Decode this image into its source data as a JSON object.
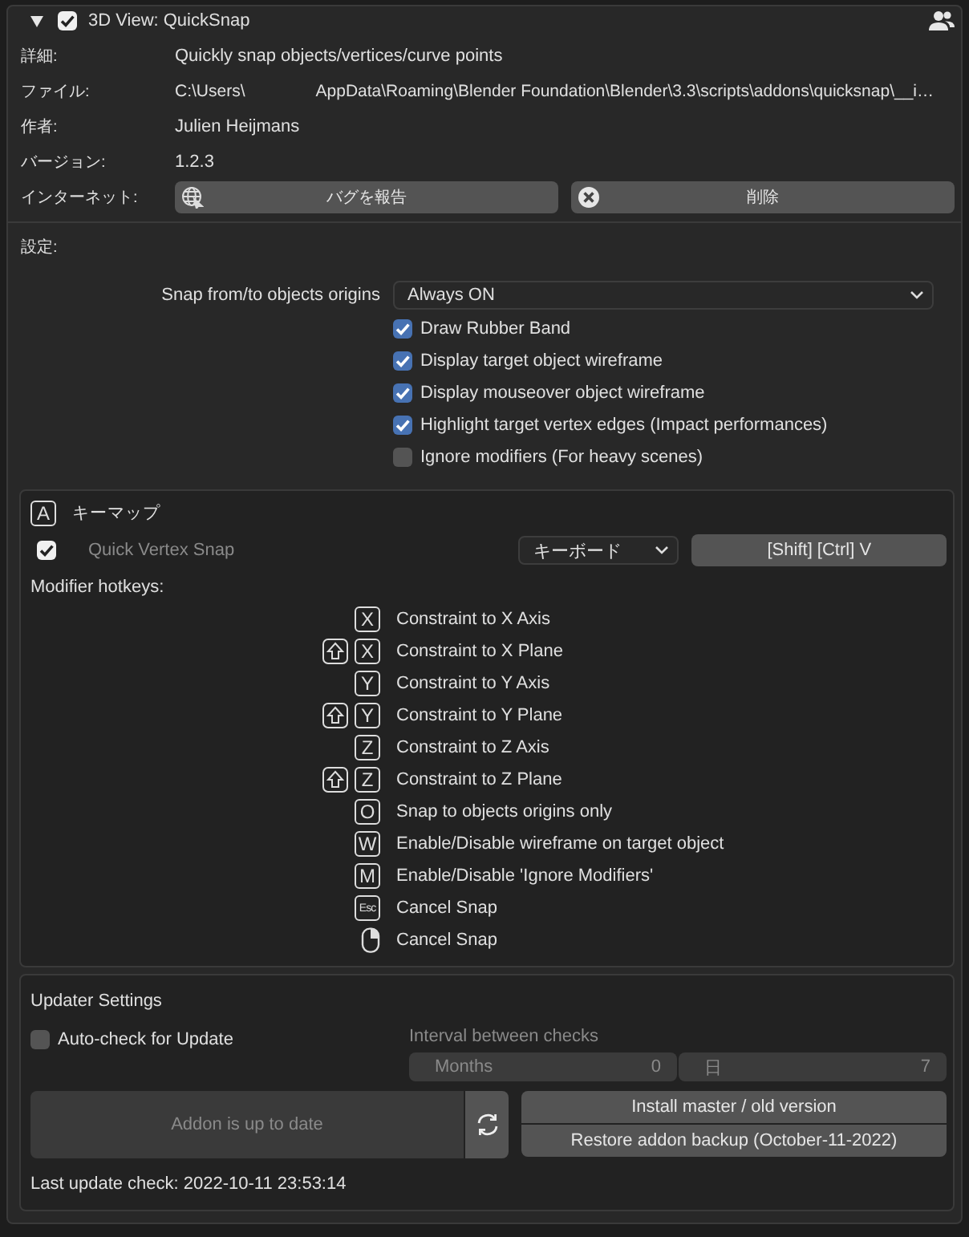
{
  "header": {
    "expanded": true,
    "enabled": true,
    "title": "3D View: QuickSnap"
  },
  "info": [
    {
      "label": "詳細:",
      "kind": "text",
      "value": "Quickly snap objects/vertices/curve points"
    },
    {
      "label": "ファイル:",
      "kind": "path",
      "parts": [
        "C:\\Users\\",
        "AppData\\Roaming\\Blender Foundation\\Blender\\3.3\\scripts\\addons\\quicksnap\\__i…"
      ]
    },
    {
      "label": "作者:",
      "kind": "text",
      "value": "Julien Heijmans"
    },
    {
      "label": "バージョン:",
      "kind": "text",
      "value": "1.2.3"
    },
    {
      "label": "インターネット:",
      "kind": "buttons",
      "buttons": [
        {
          "kind": "bug",
          "label": "バグを報告"
        },
        {
          "kind": "remove",
          "label": "削除"
        }
      ]
    }
  ],
  "settings": {
    "title": "設定:",
    "dropdown": {
      "label": "Snap from/to objects origins",
      "value": "Always ON"
    },
    "checkboxes": [
      {
        "label": "Draw Rubber Band",
        "checked": true
      },
      {
        "label": "Display target object wireframe",
        "checked": true
      },
      {
        "label": "Display mouseover object wireframe",
        "checked": true
      },
      {
        "label": "Highlight target vertex edges (Impact performances)",
        "checked": true
      },
      {
        "label": "Ignore modifiers (For heavy scenes)",
        "checked": false
      }
    ]
  },
  "keymap": {
    "badge": "A",
    "title": "キーマップ",
    "entry": {
      "checked": true,
      "disabled": true,
      "name": "Quick Vertex Snap",
      "device": "キーボード",
      "shortcut": "[Shift] [Ctrl] V"
    },
    "modifier_title": "Modifier hotkeys:",
    "hotkeys": [
      {
        "kind": "key",
        "key": "X",
        "shift": false,
        "label": "Constraint to X Axis"
      },
      {
        "kind": "key",
        "key": "X",
        "shift": true,
        "label": "Constraint to X Plane"
      },
      {
        "kind": "key",
        "key": "Y",
        "shift": false,
        "label": "Constraint to Y Axis"
      },
      {
        "kind": "key",
        "key": "Y",
        "shift": true,
        "label": "Constraint to Y Plane"
      },
      {
        "kind": "key",
        "key": "Z",
        "shift": false,
        "label": "Constraint to Z Axis"
      },
      {
        "kind": "key",
        "key": "Z",
        "shift": true,
        "label": "Constraint to Z Plane"
      },
      {
        "kind": "key",
        "key": "O",
        "shift": false,
        "label": "Snap to objects origins only"
      },
      {
        "kind": "key",
        "key": "W",
        "shift": false,
        "label": "Enable/Disable wireframe on target object"
      },
      {
        "kind": "key",
        "key": "M",
        "shift": false,
        "label": "Enable/Disable 'Ignore Modifiers'"
      },
      {
        "kind": "small-key",
        "key": "Esc",
        "shift": false,
        "label": "Cancel Snap"
      },
      {
        "kind": "mouse",
        "shift": false,
        "label": "Cancel Snap"
      }
    ]
  },
  "updater": {
    "title": "Updater Settings",
    "auto_check": {
      "label": "Auto-check for Update",
      "checked": false
    },
    "interval": {
      "label": "Interval between checks",
      "disabled": true,
      "fields": [
        {
          "label": "Months",
          "value": "0"
        },
        {
          "label": "日",
          "value": "7"
        }
      ]
    },
    "status": {
      "label": "Addon is up to date",
      "disabled": true
    },
    "buttons": [
      "Install master / old version",
      "Restore addon backup (October-11-2022)"
    ],
    "last_check": "Last update check: 2022-10-11 23:53:14"
  }
}
